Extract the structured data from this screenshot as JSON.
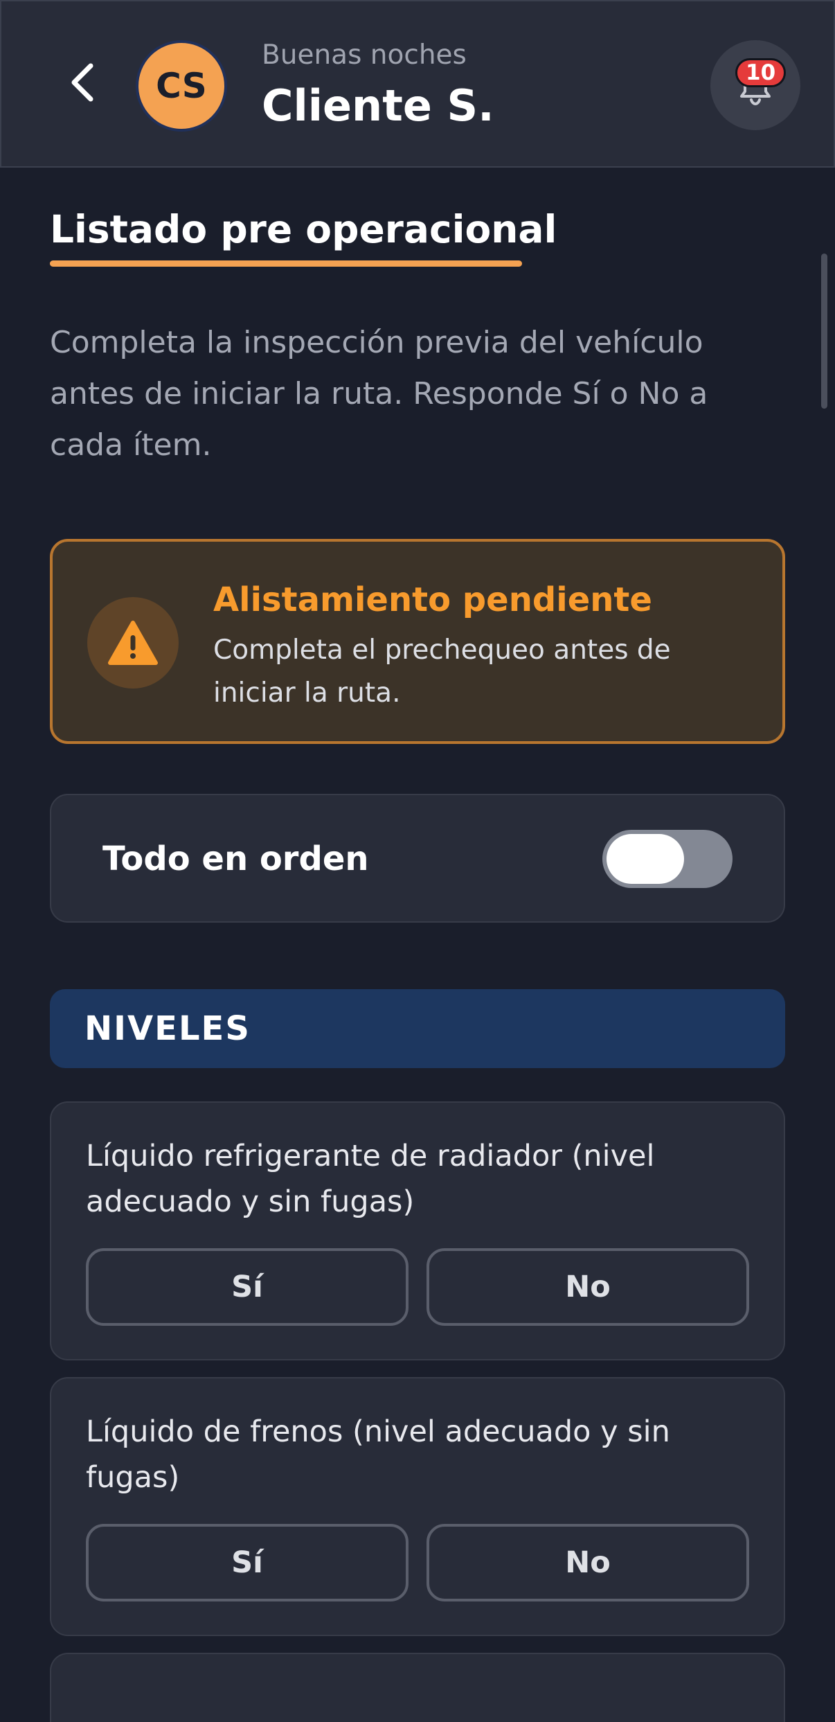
{
  "header": {
    "avatar_initials": "CS",
    "greeting": "Buenas noches",
    "user_name": "Cliente S.",
    "notifications_count": "10"
  },
  "page": {
    "title": "Listado pre operacional",
    "intro": "Completa la inspección previa del vehículo antes de iniciar la ruta. Responde Sí o No a cada ítem."
  },
  "alert": {
    "title": "Alistamiento pendiente",
    "body": "Completa el prechequeo antes de iniciar la ruta."
  },
  "all_ok": {
    "label": "Todo en orden",
    "enabled": false
  },
  "category": {
    "label": "NIVELES"
  },
  "items": [
    {
      "text": "Líquido refrigerante de radiador (nivel adecuado y sin fugas)",
      "yes_label": "Sí",
      "no_label": "No"
    },
    {
      "text": "Líquido de frenos (nivel adecuado y sin fugas)",
      "yes_label": "Sí",
      "no_label": "No"
    }
  ],
  "colors": {
    "background": "#1a1e2b",
    "accent": "#f4a252",
    "warning": "#f89b2d",
    "category": "#1d3760",
    "badge": "#e53b3b"
  },
  "icons": [
    "chevron-left-icon",
    "bell-icon",
    "warning-icon"
  ]
}
